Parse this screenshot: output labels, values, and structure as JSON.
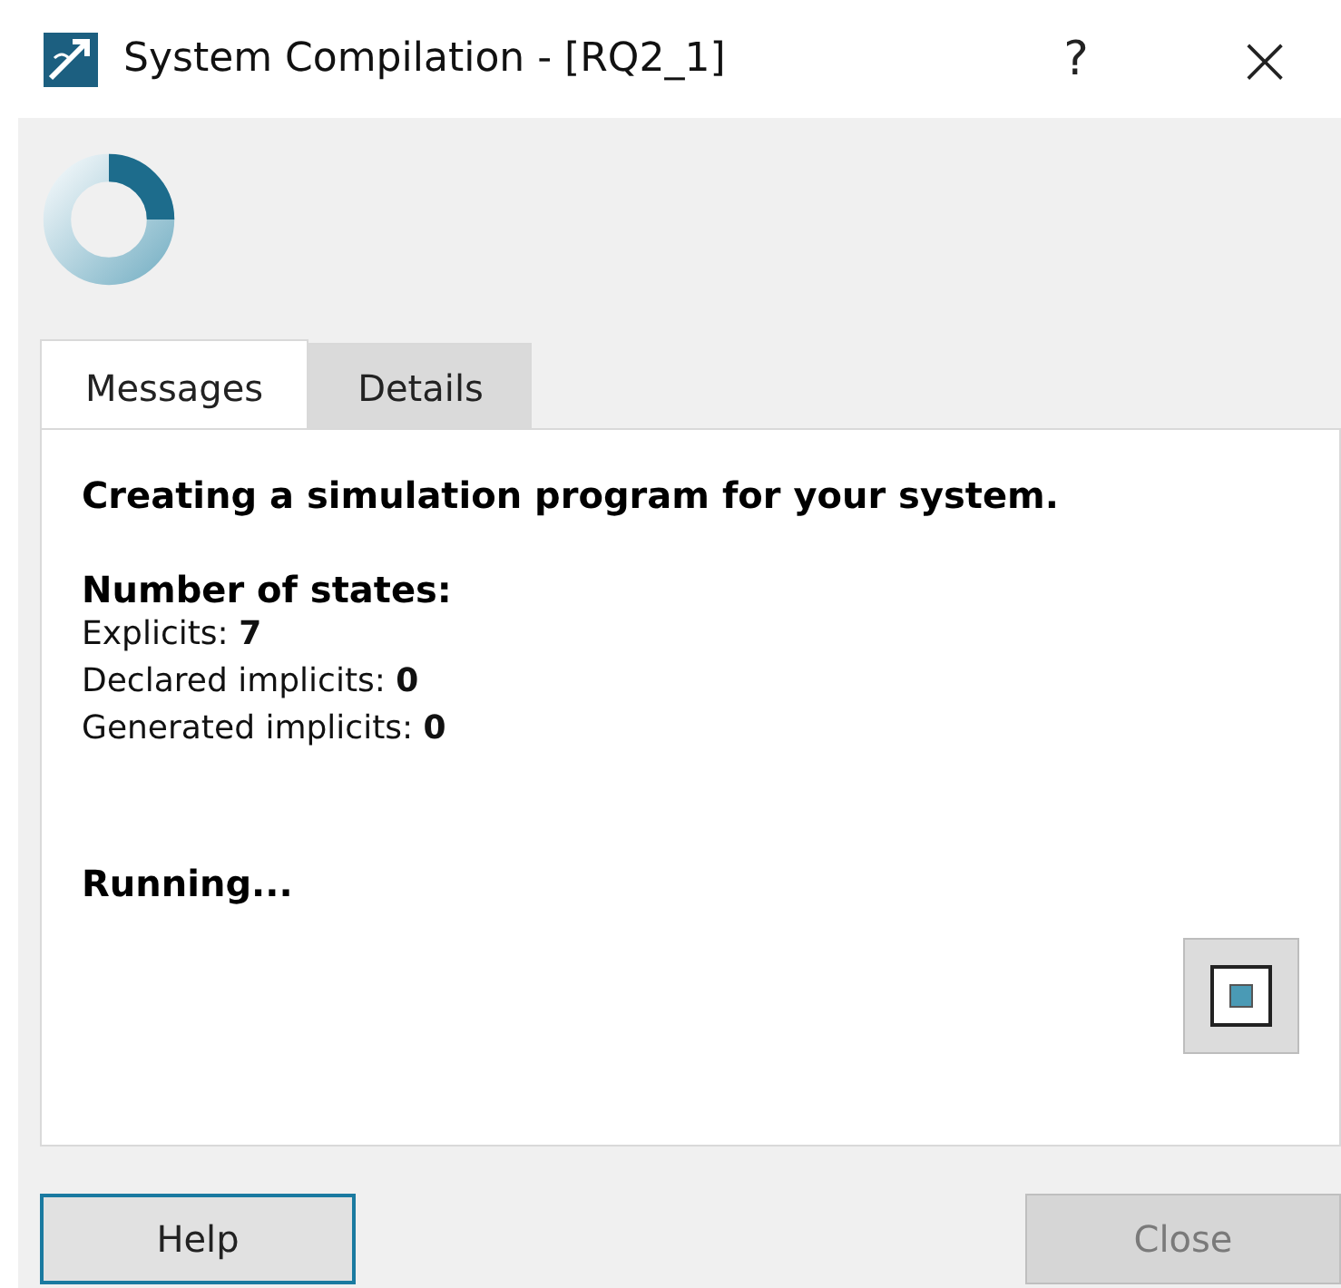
{
  "window": {
    "title": "System Compilation - [RQ2_1]",
    "help": "?",
    "close": "×"
  },
  "tabs": [
    {
      "label": "Messages",
      "selected": true
    },
    {
      "label": "Details",
      "selected": false
    }
  ],
  "messages": {
    "heading": "Creating a simulation program for your system.",
    "states_heading": "Number of states:",
    "lines": [
      "Explicits: **7**",
      "Declared implicits: **0**",
      "Generated implicits: **0**"
    ],
    "status": "Running..."
  },
  "buttons": [
    {
      "label": "Help",
      "default": true,
      "disabled": false
    },
    {
      "label": "Close",
      "default": false,
      "disabled": true
    }
  ]
}
